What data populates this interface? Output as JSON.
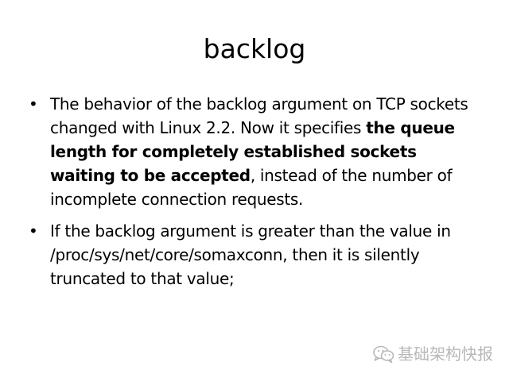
{
  "slide": {
    "title": "backlog",
    "bullet_symbol": "•",
    "bullets": [
      {
        "text_1": "The behavior of the backlog argument on TCP sockets changed with Linux 2.2. Now it specifies ",
        "bold": "the queue length for completely established sockets waiting to be accepted",
        "text_2": ", instead of the number of incomplete connection requests."
      },
      {
        "text_1": "If the backlog argument is greater than the value in /proc/sys/net/core/somaxconn, then it is silently truncated to that value;"
      }
    ]
  },
  "watermark": {
    "text": "基础架构快报",
    "icon": "wechat-icon"
  }
}
